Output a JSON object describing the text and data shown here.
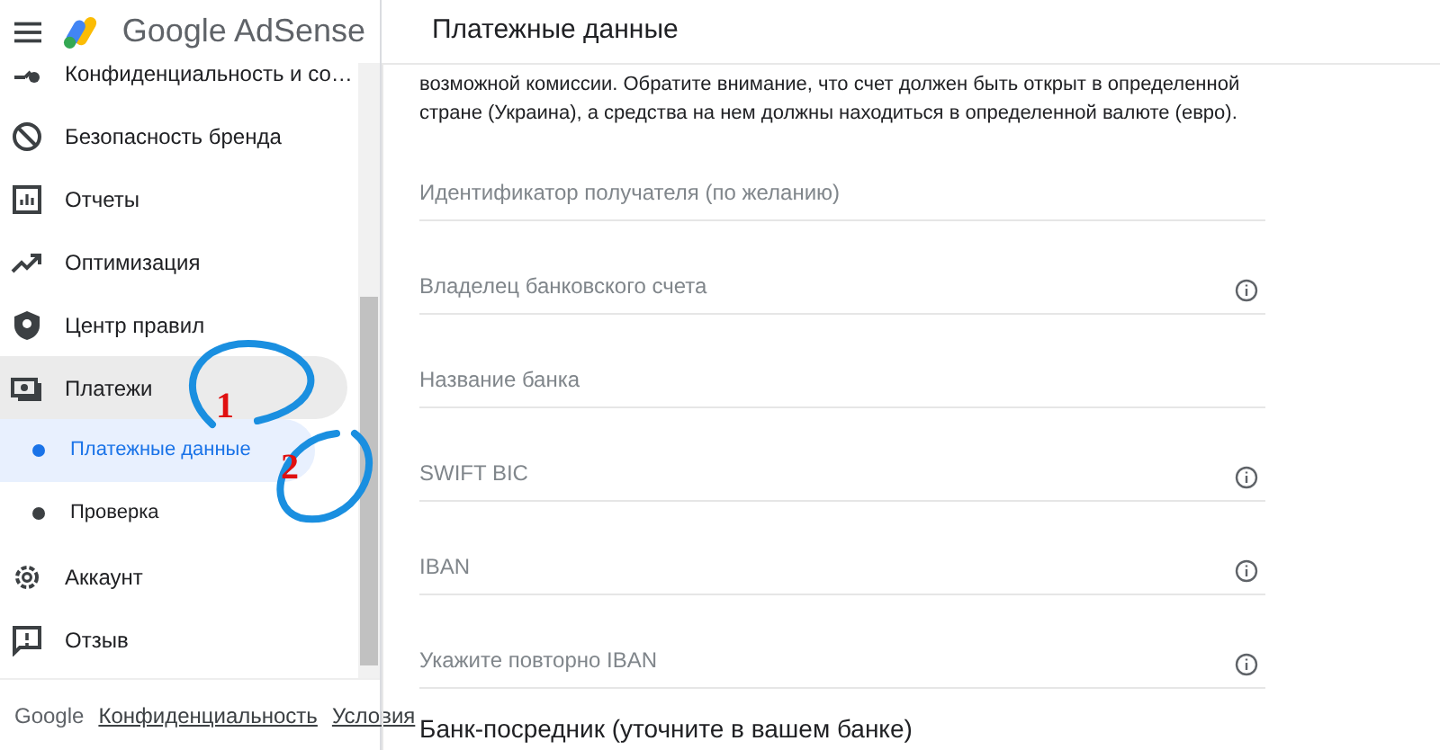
{
  "app": {
    "name": "Google AdSense"
  },
  "sidebar": {
    "items": [
      {
        "label": "Конфиденциальность и со…",
        "selected": false
      },
      {
        "label": "Безопасность бренда",
        "selected": false
      },
      {
        "label": "Отчеты",
        "selected": false
      },
      {
        "label": "Оптимизация",
        "selected": false
      },
      {
        "label": "Центр правил",
        "selected": false
      },
      {
        "label": "Платежи",
        "selected": true,
        "children": [
          {
            "label": "Платежные данные",
            "selected": true
          },
          {
            "label": "Проверка",
            "selected": false
          }
        ]
      },
      {
        "label": "Аккаунт",
        "selected": false
      },
      {
        "label": "Отзыв",
        "selected": false
      }
    ]
  },
  "footer": {
    "brand": "Google",
    "links": [
      "Конфиденциальность",
      "Условия"
    ]
  },
  "page": {
    "title": "Платежные данные",
    "description": "возможной комиссии. Обратите внимание, что счет должен быть открыт в определенной стране (Украина), а средства на нем должны находиться в определенной валюте (евро).",
    "fields": [
      {
        "placeholder": "Идентификатор получателя (по желанию)",
        "info": false
      },
      {
        "placeholder": "Владелец банковского счета",
        "info": true
      },
      {
        "placeholder": "Название банка",
        "info": false
      },
      {
        "placeholder": "SWIFT BIC",
        "info": true
      },
      {
        "placeholder": "IBAN",
        "info": true
      },
      {
        "placeholder": "Укажите повторно IBAN",
        "info": true
      }
    ],
    "section": "Банк-посредник (уточните в вашем банке)"
  },
  "annotations": [
    {
      "label": "1"
    },
    {
      "label": "2"
    }
  ]
}
